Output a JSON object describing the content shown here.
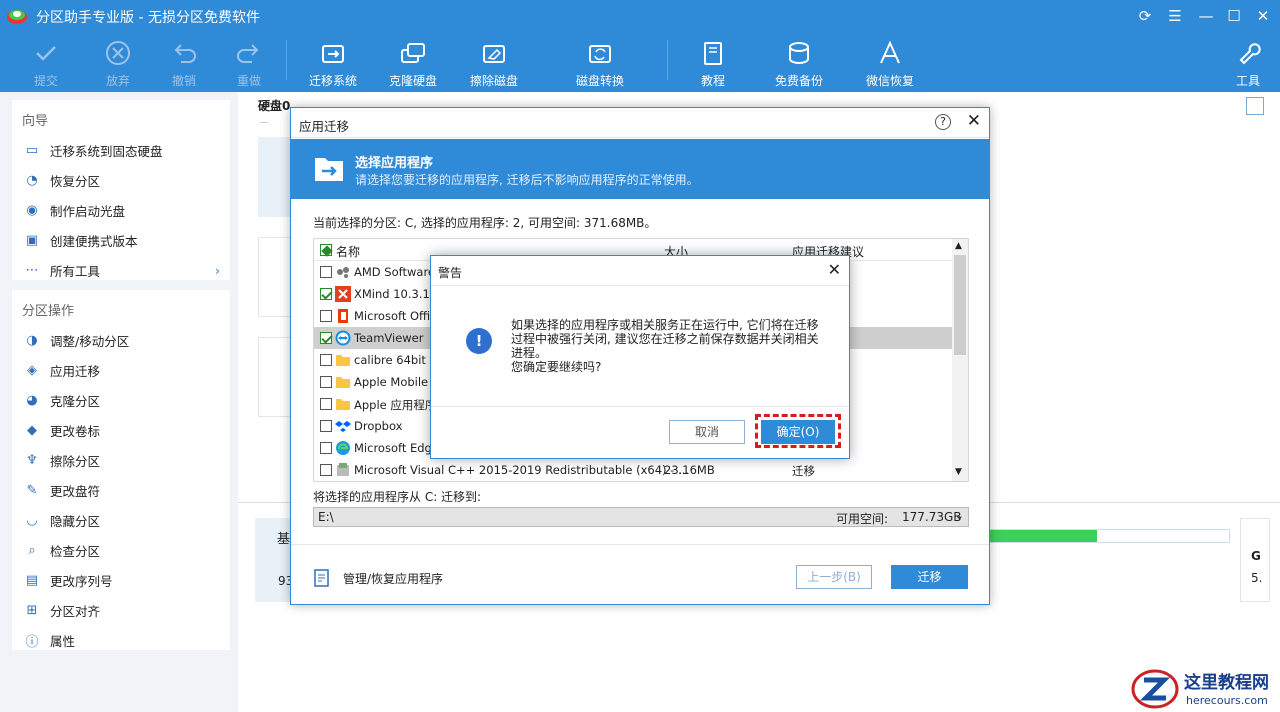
{
  "app": {
    "title": "分区助手专业版 - 无损分区免费软件"
  },
  "toolbar": {
    "submit": "提交",
    "discard": "放弃",
    "undo": "撤销",
    "redo": "重做",
    "migrate_os": "迁移系统",
    "clone_disk": "克隆硬盘",
    "wipe_disk": "擦除磁盘",
    "disk_convert": "磁盘转换",
    "tutorial": "教程",
    "free_backup": "免费备份",
    "wechat_recover": "微信恢复",
    "tools": "工具"
  },
  "sidebar": {
    "guide_title": "向导",
    "guide_items": [
      {
        "label": "迁移系统到固态硬盘",
        "icon": "migrate-icon"
      },
      {
        "label": "恢复分区",
        "icon": "recover-icon"
      },
      {
        "label": "制作启动光盘",
        "icon": "bootdisk-icon"
      },
      {
        "label": "创建便携式版本",
        "icon": "portable-icon"
      },
      {
        "label": "所有工具",
        "icon": "more-icon"
      }
    ],
    "ops_title": "分区操作",
    "ops_items": [
      {
        "label": "调整/移动分区",
        "icon": "resize-icon"
      },
      {
        "label": "应用迁移",
        "icon": "app-migrate-icon"
      },
      {
        "label": "克隆分区",
        "icon": "clone-icon"
      },
      {
        "label": "更改卷标",
        "icon": "tag-icon"
      },
      {
        "label": "擦除分区",
        "icon": "wipe-icon"
      },
      {
        "label": "更改盘符",
        "icon": "pencil-icon"
      },
      {
        "label": "隐藏分区",
        "icon": "hide-icon"
      },
      {
        "label": "检查分区",
        "icon": "check-icon"
      },
      {
        "label": "更改序列号",
        "icon": "serial-icon"
      },
      {
        "label": "分区对齐",
        "icon": "align-icon"
      },
      {
        "label": "属性",
        "icon": "info-icon"
      }
    ]
  },
  "main": {
    "disk0": "硬盘0",
    "bottom_label1": "基",
    "bottom_label2": "93",
    "right_label1": "G",
    "right_label2": "5."
  },
  "dialog": {
    "title": "应用迁移",
    "banner_title": "选择应用程序",
    "banner_sub": "请选择您要迁移的应用程序, 迁移后不影响应用程序的正常使用。",
    "info": "当前选择的分区: C, 选择的应用程序: 2, 可用空间: 371.68MB。",
    "col_name": "名称",
    "col_size": "大小",
    "col_advice": "应用迁移建议",
    "apps": [
      {
        "name": "AMD Software",
        "checked": false
      },
      {
        "name": "XMind 10.3.1",
        "checked": true
      },
      {
        "name": "Microsoft Office",
        "checked": false
      },
      {
        "name": "TeamViewer",
        "checked": true
      },
      {
        "name": "calibre 64bit",
        "checked": false
      },
      {
        "name": "Apple Mobile De",
        "checked": false
      },
      {
        "name": "Apple 应用程序",
        "checked": false
      },
      {
        "name": "Dropbox",
        "checked": false
      },
      {
        "name": "Microsoft Edge",
        "checked": false
      },
      {
        "name": "Microsoft Visual C++ 2015-2019 Redistributable (x64) - ...",
        "size": "23.16MB",
        "advice": "迁移",
        "checked": false
      }
    ],
    "dest_label": "将选择的应用程序从 C: 迁移到:",
    "dest_value": "E:\\",
    "free_label": "可用空间:",
    "free_value": "177.73GB",
    "manage": "管理/恢复应用程序",
    "back": "上一步(B)",
    "migrate": "迁移"
  },
  "warning": {
    "title": "警告",
    "line1": "如果选择的应用程序或相关服务正在运行中, 它们将在迁移",
    "line2": "过程中被强行关闭, 建议您在迁移之前保存数据并关闭相关",
    "line3": "进程。",
    "line4": "您确定要继续吗?",
    "cancel": "取消",
    "ok": "确定(O)"
  },
  "watermark": {
    "line1": "这里教程网",
    "line2": "herecours.com"
  }
}
